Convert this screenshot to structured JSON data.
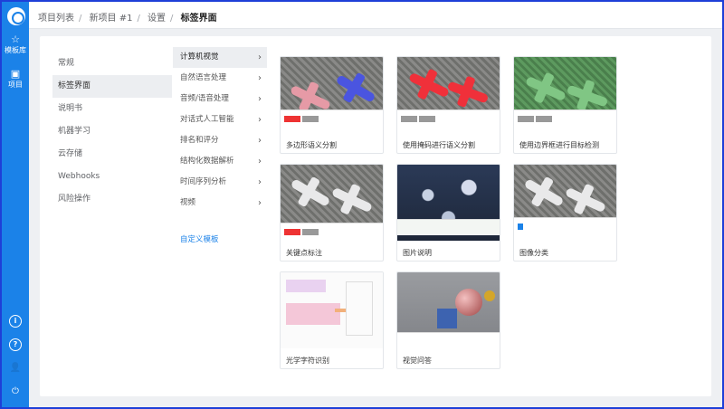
{
  "sidebar": {
    "items": [
      {
        "icon": "star-icon",
        "label": "模板库"
      },
      {
        "icon": "folder-icon",
        "label": "项目"
      }
    ],
    "bottom_icons": [
      "info-icon",
      "help-icon",
      "user-icon",
      "power-icon"
    ]
  },
  "breadcrumb": {
    "items": [
      "项目列表",
      "新项目 #1",
      "设置"
    ],
    "current": "标签界面"
  },
  "settings_nav": {
    "items": [
      "常规",
      "标签界面",
      "说明书",
      "机器学习",
      "云存储",
      "Webhooks",
      "风险操作"
    ],
    "active": "标签界面"
  },
  "category_nav": {
    "items": [
      "计算机视觉",
      "自然语言处理",
      "音频/语音处理",
      "对话式人工智能",
      "排名和评分",
      "结构化数据解析",
      "时间序列分析",
      "视频"
    ],
    "active": "计算机视觉",
    "custom_link": "自定义模板"
  },
  "templates": [
    {
      "title": "多边形语义分割"
    },
    {
      "title": "使用掩码进行语义分割"
    },
    {
      "title": "使用边界框进行目标检测"
    },
    {
      "title": "关键点标注"
    },
    {
      "title": "图片说明"
    },
    {
      "title": "图像分类"
    },
    {
      "title": "光学字符识别"
    },
    {
      "title": "视觉问答"
    }
  ],
  "colors": {
    "sidebar": "#1b82e8",
    "accent": "#1b82e8",
    "frame_border": "#1e3fd8"
  }
}
